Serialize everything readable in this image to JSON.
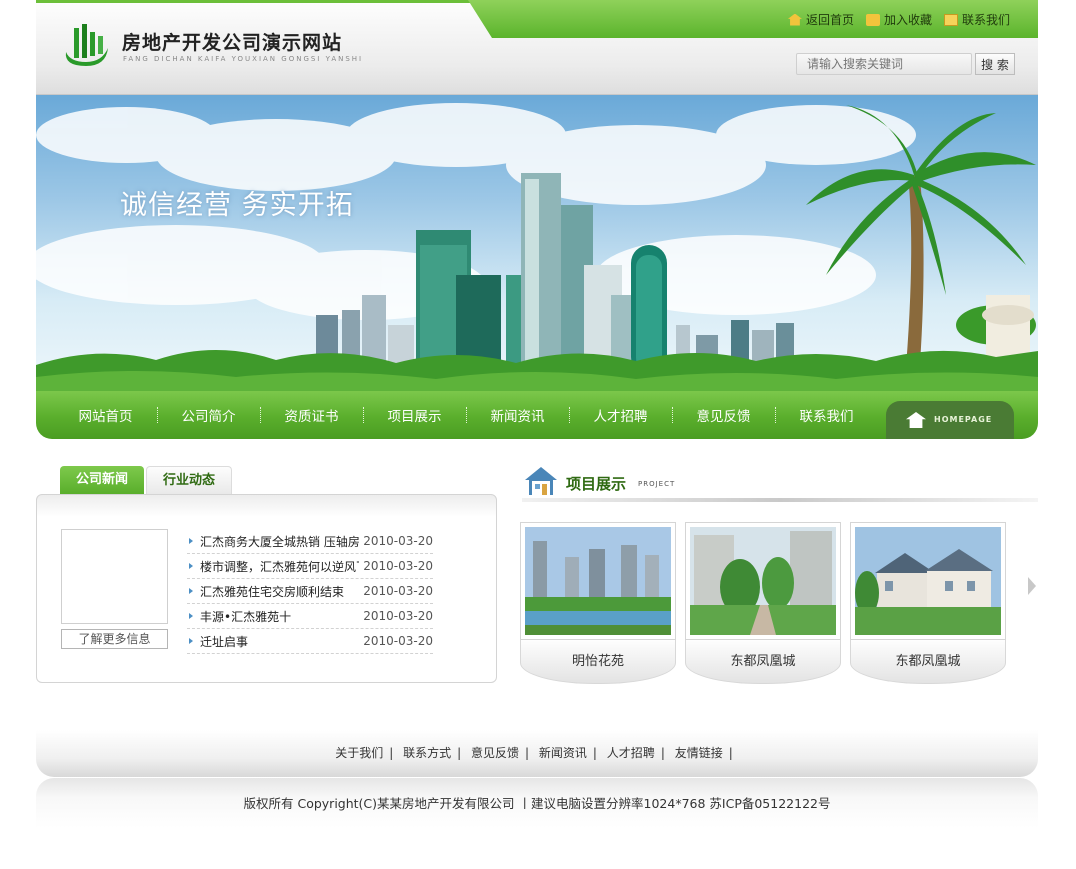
{
  "header": {
    "site_title": "房地产开发公司演示网站",
    "site_subtitle": "FANG DICHAN KAIFA YOUXIAN GONGSI YANSHI",
    "top_links": [
      {
        "label": "返回首页",
        "icon": "home-icon"
      },
      {
        "label": "加入收藏",
        "icon": "bookmark-icon"
      },
      {
        "label": "联系我们",
        "icon": "mail-icon"
      }
    ],
    "search_placeholder": "请输入搜索关键词",
    "search_button": "搜 索"
  },
  "banner": {
    "slogan": "诚信经营  务实开拓"
  },
  "nav": {
    "items": [
      "网站首页",
      "公司简介",
      "资质证书",
      "项目展示",
      "新闻资讯",
      "人才招聘",
      "意见反馈",
      "联系我们"
    ],
    "homepage_tab": "HOMEPAGE"
  },
  "news": {
    "tabs": [
      "公司新闻",
      "行业动态"
    ],
    "more_info": "了解更多信息",
    "items": [
      {
        "title": "汇杰商务大厦全城热销 压轴房",
        "date": "2010-03-20"
      },
      {
        "title": "楼市调整，汇杰雅苑何以逆风飞",
        "date": "2010-03-20"
      },
      {
        "title": "汇杰雅苑住宅交房顺利结束",
        "date": "2010-03-20"
      },
      {
        "title": "丰源•汇杰雅苑十",
        "date": "2010-03-20"
      },
      {
        "title": "迁址启事",
        "date": "2010-03-20"
      }
    ]
  },
  "projects": {
    "title": "项目展示",
    "subtitle": "PROJECT",
    "items": [
      {
        "name": "明怡花苑"
      },
      {
        "name": "东都凤凰城"
      },
      {
        "name": "东都凤凰城"
      }
    ]
  },
  "footer": {
    "links": [
      "关于我们",
      "联系方式",
      "意见反馈",
      "新闻资讯",
      "人才招聘",
      "友情链接"
    ],
    "separator": "|",
    "copyright": "版权所有 Copyright(C)某某房地产开发有限公司 丨建议电脑设置分辨率1024*768 苏ICP备05122122号"
  },
  "colors": {
    "brand_green": "#5aae2c",
    "dark_green": "#2f6a12",
    "homepage_tab": "#4a7b34"
  }
}
